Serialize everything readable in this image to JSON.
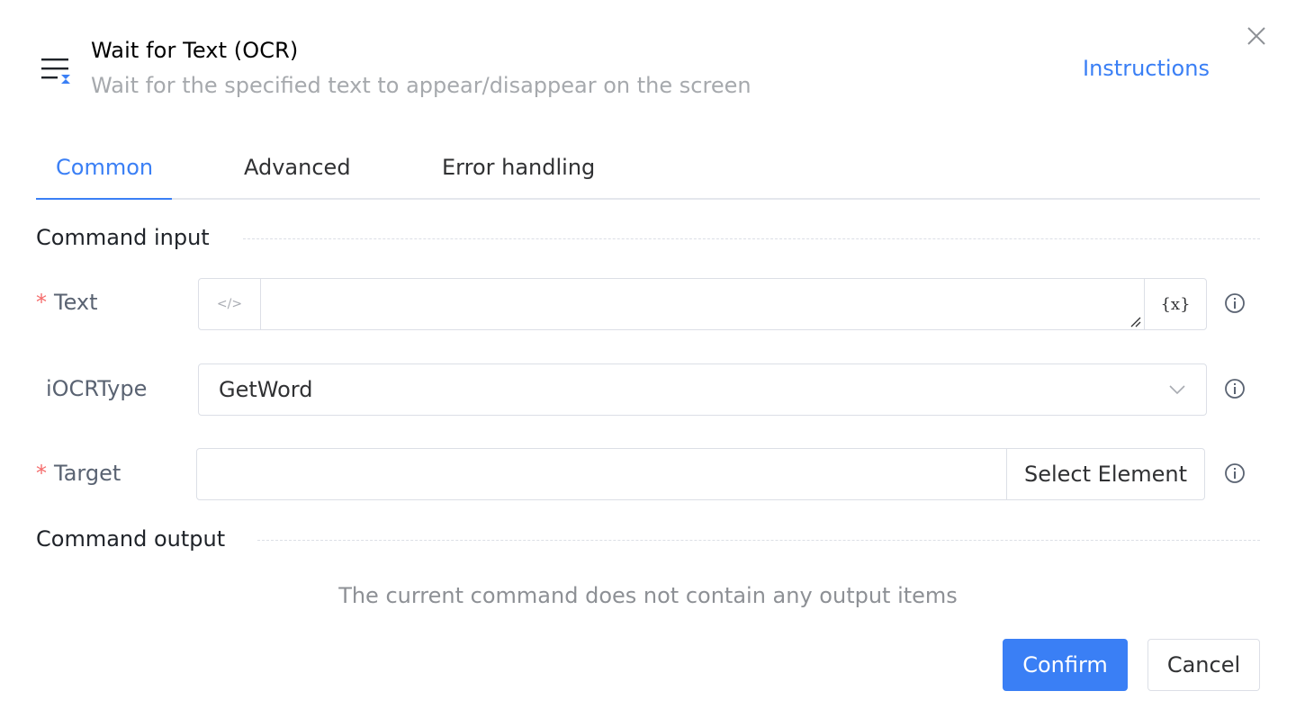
{
  "header": {
    "title": "Wait for Text (OCR)",
    "subtitle": "Wait for the specified text to appear/disappear on the screen",
    "instructions_link": "Instructions",
    "icon": "list-hourglass-icon"
  },
  "tabs": [
    {
      "label": "Common",
      "active": true
    },
    {
      "label": "Advanced",
      "active": false
    },
    {
      "label": "Error handling",
      "active": false
    }
  ],
  "sections": {
    "input_title": "Command input",
    "output_title": "Command output",
    "output_empty": "The current command does not contain any output items"
  },
  "fields": {
    "text": {
      "label": "Text",
      "required_mark": "*",
      "value": "",
      "code_icon": "</>",
      "var_icon": "{x}"
    },
    "iocrtype": {
      "label": "iOCRType",
      "value": "GetWord"
    },
    "target": {
      "label": "Target",
      "required_mark": "*",
      "value": "",
      "button": "Select Element"
    }
  },
  "footer": {
    "confirm": "Confirm",
    "cancel": "Cancel"
  },
  "colors": {
    "accent": "#3a7ff5",
    "required": "#f56c6c",
    "muted": "#a6a9ad"
  }
}
